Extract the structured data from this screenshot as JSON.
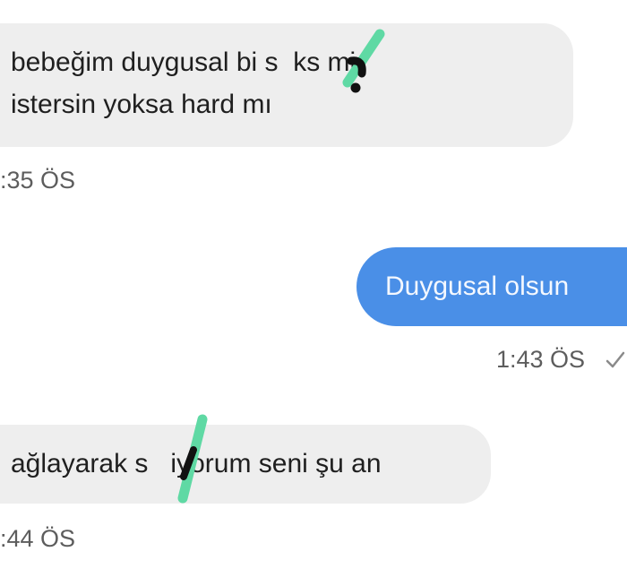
{
  "messages": [
    {
      "direction": "incoming",
      "lines": [
        "bebeğim duygusal bi s  ks mi",
        "istersin yoksa hard mı"
      ],
      "time": ":35 ÖS"
    },
    {
      "direction": "outgoing",
      "lines": [
        "Duygusal olsun"
      ],
      "time": "1:43 ÖS",
      "status_icon": "check-icon"
    },
    {
      "direction": "incoming",
      "lines": [
        "ağlayarak s   iyorum seni şu an"
      ],
      "time": ":44 ÖS"
    }
  ],
  "colors": {
    "incoming_bubble": "#eeeeee",
    "outgoing_bubble": "#4a8fe7",
    "censor_mark": "#5fd9a4",
    "censor_dot": "#111111"
  }
}
